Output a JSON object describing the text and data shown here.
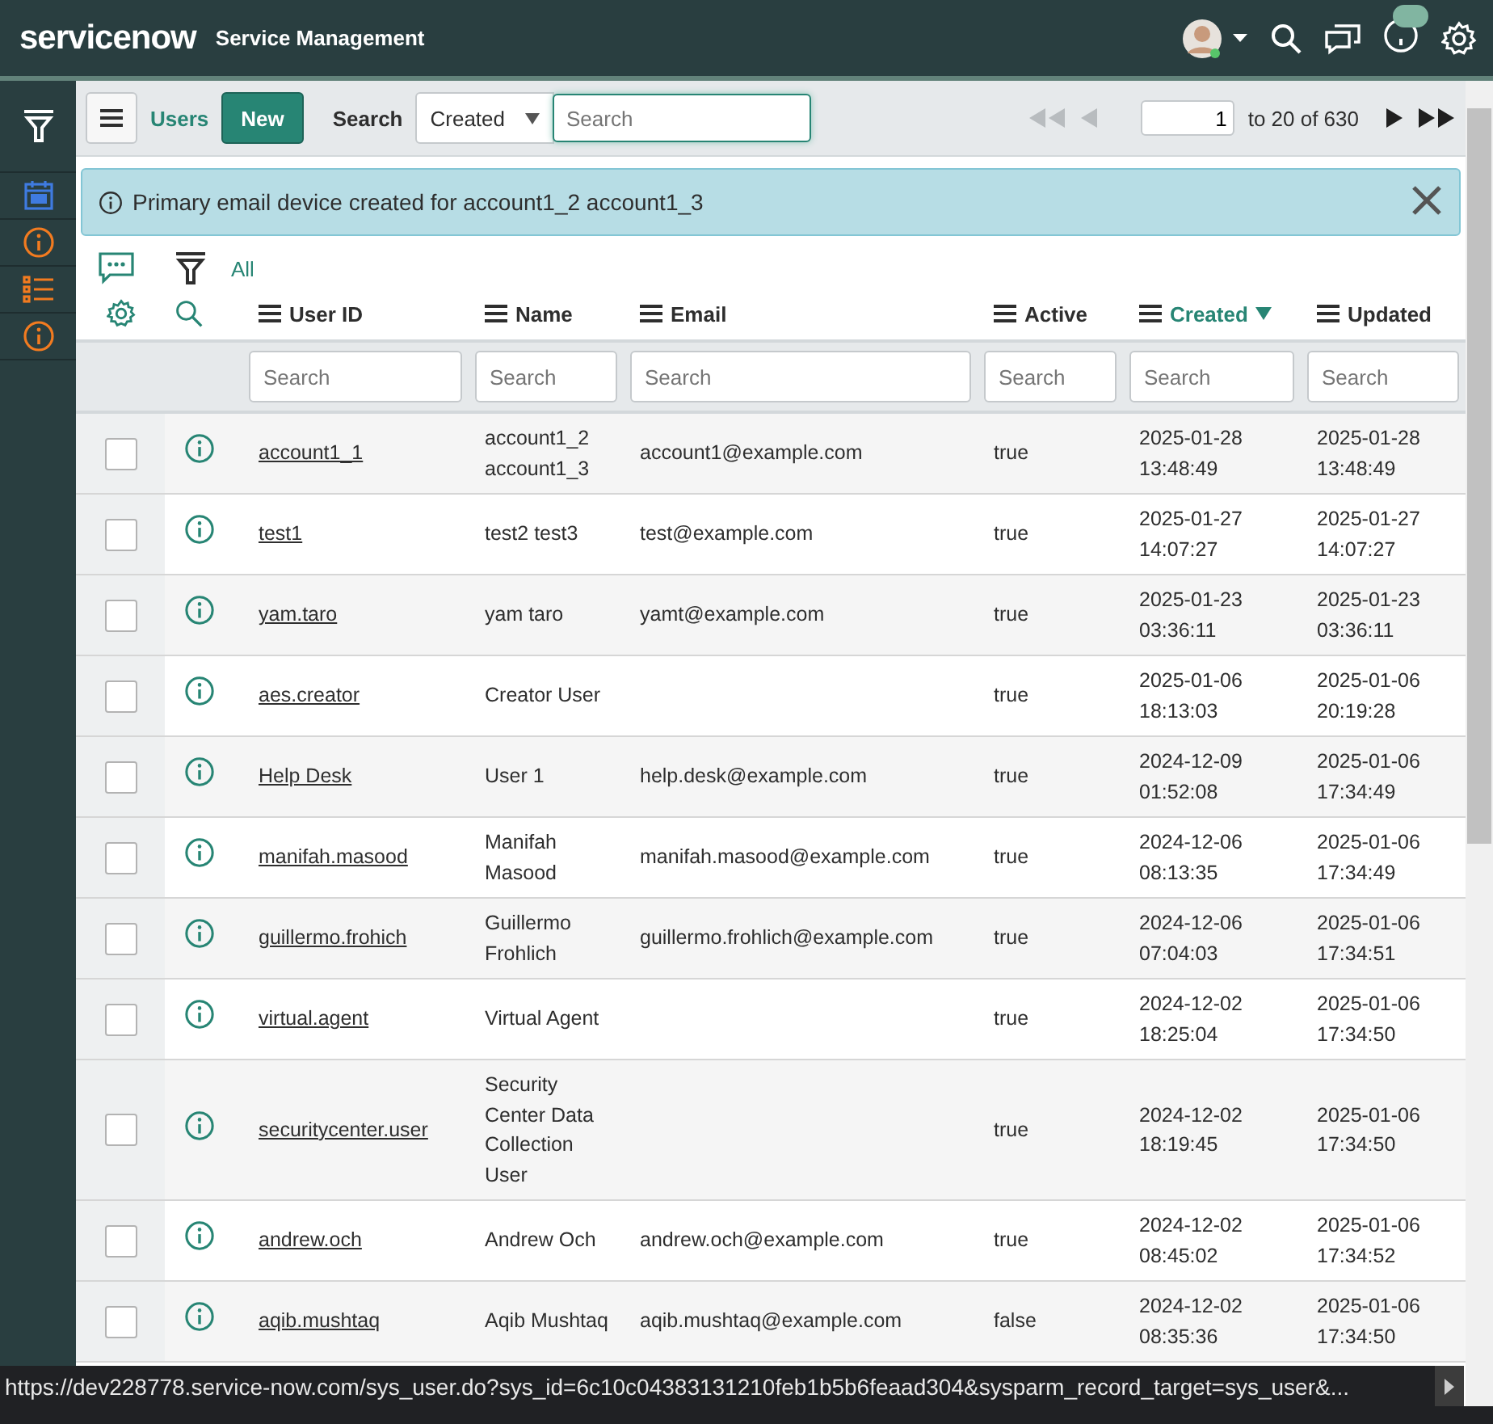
{
  "header": {
    "logo": "servicenow",
    "title": "Service Management"
  },
  "sidebar": {
    "items": [
      {
        "kind": "calendar"
      },
      {
        "kind": "info"
      },
      {
        "kind": "list"
      },
      {
        "kind": "info"
      }
    ]
  },
  "toolbar": {
    "list_title": "Users",
    "new_button": "New",
    "search_label": "Search",
    "search_field": "Created",
    "search_input": {
      "placeholder": "Search"
    },
    "pagination": {
      "page": "1",
      "range": "to 20 of 630"
    }
  },
  "notification": {
    "message": "Primary email device created for account1_2 account1_3"
  },
  "breadcrumb": "All",
  "table": {
    "columns": [
      {
        "label": "User ID",
        "sorted": false,
        "filter_placeholder": "Search"
      },
      {
        "label": "Name",
        "sorted": false,
        "filter_placeholder": "Search"
      },
      {
        "label": "Email",
        "sorted": false,
        "filter_placeholder": "Search"
      },
      {
        "label": "Active",
        "sorted": false,
        "filter_placeholder": "Search"
      },
      {
        "label": "Created",
        "sorted": true,
        "filter_placeholder": "Search"
      },
      {
        "label": "Updated",
        "sorted": false,
        "filter_placeholder": "Search"
      }
    ],
    "rows": [
      {
        "checked": false,
        "user_id": "account1_1",
        "name": "account1_2 account1_3",
        "email": "account1@example.com",
        "active": "true",
        "created": "2025-01-28 13:48:49",
        "updated": "2025-01-28 13:48:49"
      },
      {
        "checked": false,
        "user_id": "test1",
        "name": "test2 test3",
        "email": "test@example.com",
        "active": "true",
        "created": "2025-01-27 14:07:27",
        "updated": "2025-01-27 14:07:27"
      },
      {
        "checked": false,
        "user_id": "yam.taro",
        "name": "yam taro",
        "email": "yamt@example.com",
        "active": "true",
        "created": "2025-01-23 03:36:11",
        "updated": "2025-01-23 03:36:11"
      },
      {
        "checked": false,
        "user_id": "aes.creator",
        "name": "Creator User",
        "active": "true",
        "created": "2025-01-06 18:13:03",
        "updated": "2025-01-06 20:19:28"
      },
      {
        "checked": false,
        "user_id": "Help Desk",
        "name": "User 1",
        "email": "help.desk@example.com",
        "active": "true",
        "created": "2024-12-09 01:52:08",
        "updated": "2025-01-06 17:34:49"
      },
      {
        "checked": false,
        "user_id": "manifah.masood",
        "name": "Manifah Masood",
        "email": "manifah.masood@example.com",
        "active": "true",
        "created": "2024-12-06 08:13:35",
        "updated": "2025-01-06 17:34:49"
      },
      {
        "checked": false,
        "user_id": "guillermo.frohich",
        "name": "Guillermo Frohlich",
        "email": "guillermo.frohlich@example.com",
        "active": "true",
        "created": "2024-12-06 07:04:03",
        "updated": "2025-01-06 17:34:51"
      },
      {
        "checked": false,
        "user_id": "virtual.agent",
        "name": "Virtual Agent",
        "active": "true",
        "created": "2024-12-02 18:25:04",
        "updated": "2025-01-06 17:34:50"
      },
      {
        "checked": false,
        "user_id": "securitycenter.user",
        "name": "Security Center Data Collection User",
        "active": "true",
        "created": "2024-12-02 18:19:45",
        "updated": "2025-01-06 17:34:50"
      },
      {
        "checked": false,
        "user_id": "andrew.och",
        "name": "Andrew Och",
        "email": "andrew.och@example.com",
        "active": "true",
        "created": "2024-12-02 08:45:02",
        "updated": "2025-01-06 17:34:52"
      },
      {
        "checked": false,
        "user_id": "aqib.mushtaq",
        "name": "Aqib Mushtaq",
        "email": "aqib.mushtaq@example.com",
        "active": "false",
        "created": "2024-12-02 08:35:36",
        "updated": "2025-01-06 17:34:50"
      }
    ]
  },
  "status_url": "https://dev228778.service-now.com/sys_user.do?sys_id=6c10c04383131210feb1b5b6feaad304&sysparm_record_target=sys_user&..."
}
